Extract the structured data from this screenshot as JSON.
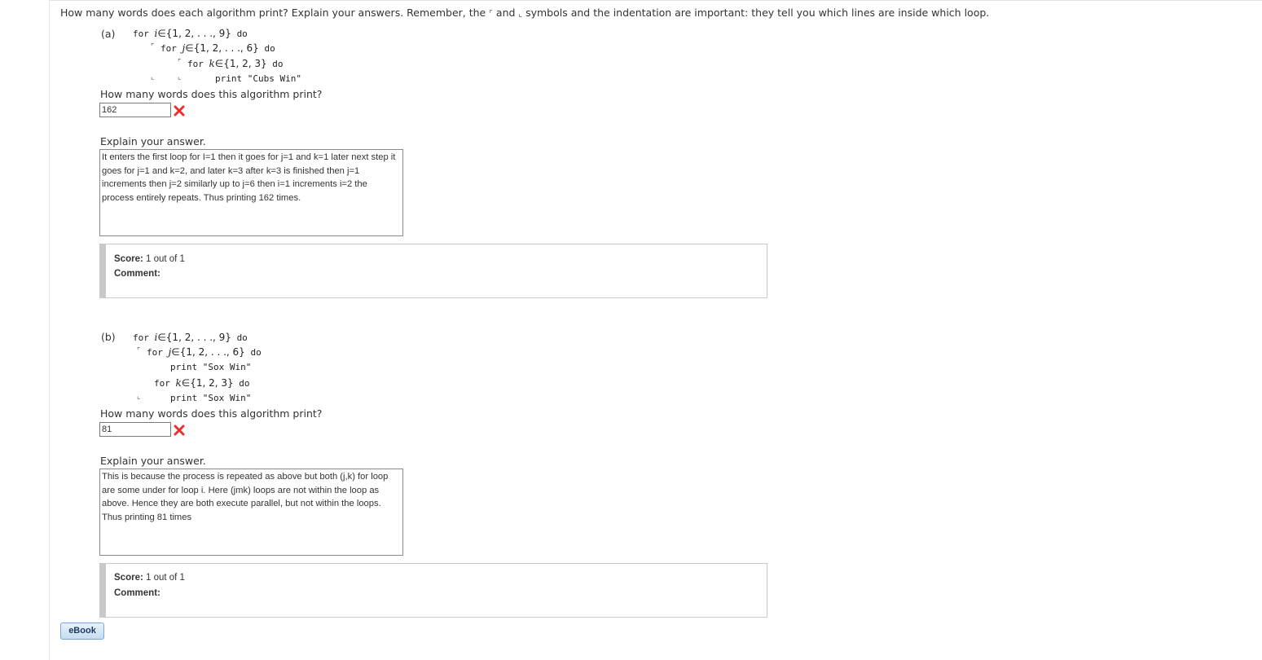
{
  "question": {
    "text_before": "How many words does each algorithm print? Explain your answers. Remember, the",
    "open_bracket": "⌜",
    "text_and": "and",
    "close_bracket": "⌞",
    "text_after": "symbols and the indentation are important: they tell you which lines are inside which loop."
  },
  "part_a": {
    "label": "(a)",
    "line1": {
      "kw": "for",
      "var": "i",
      "set": "∈{1, 2, . . ., 9}",
      "end": "do"
    },
    "line2": {
      "bracket": "⌜",
      "kw": "for",
      "var": "j",
      "set": "∈{1, 2, . . ., 6}",
      "end": "do"
    },
    "line3": {
      "bracket": "⌜",
      "kw": "for",
      "var": "k",
      "set": "∈{1, 2, 3}",
      "end": "do"
    },
    "line4": {
      "bracket1": "⌞",
      "bracket2": "⌞",
      "stmt": "print \"Cubs Win\""
    },
    "prompt": "How many words does this algorithm print?",
    "answer": "162",
    "explain_label": "Explain your answer.",
    "explanation": "It enters the first loop for I=1 then it goes for j=1 and k=1 later next step it goes for j=1 and k=2, and later k=3 after k=3 is finished then j=1 increments then j=2 similarly up to j=6 then i=1 increments i=2 the process entirely repeats. Thus printing 162 times.",
    "score_label": "Score:",
    "score_value": "1 out of 1",
    "comment_label": "Comment:"
  },
  "part_b": {
    "label": "(b)",
    "line1": {
      "kw": "for",
      "var": "i",
      "set": "∈{1, 2, . . ., 9}",
      "end": "do"
    },
    "line2": {
      "bracket": "⌜",
      "kw": "for",
      "var": "j",
      "set": "∈{1, 2, . . ., 6}",
      "end": "do"
    },
    "line3": {
      "stmt": "print \"Sox Win\""
    },
    "line4": {
      "kw": "for",
      "var": "k",
      "set": "∈{1, 2, 3}",
      "end": "do"
    },
    "line5": {
      "bracket": "⌞",
      "stmt": "print \"Sox Win\""
    },
    "prompt": "How many words does this algorithm print?",
    "answer": "81",
    "explain_label": "Explain your answer.",
    "explanation": "This is because the process is repeated as above but both (j,k) for loop are some under for loop i. Here (jmk) loops are not within the loop as above. Hence they are both execute parallel, but not within the loops. Thus printing 81 times",
    "score_label": "Score:",
    "score_value": "1 out of 1",
    "comment_label": "Comment:"
  },
  "ebook": {
    "label": "eBook"
  },
  "colors": {
    "incorrect_mark": "#e8322f",
    "score_bar": "#c9c9c9"
  },
  "icons": {
    "incorrect": "x-mark-icon"
  }
}
